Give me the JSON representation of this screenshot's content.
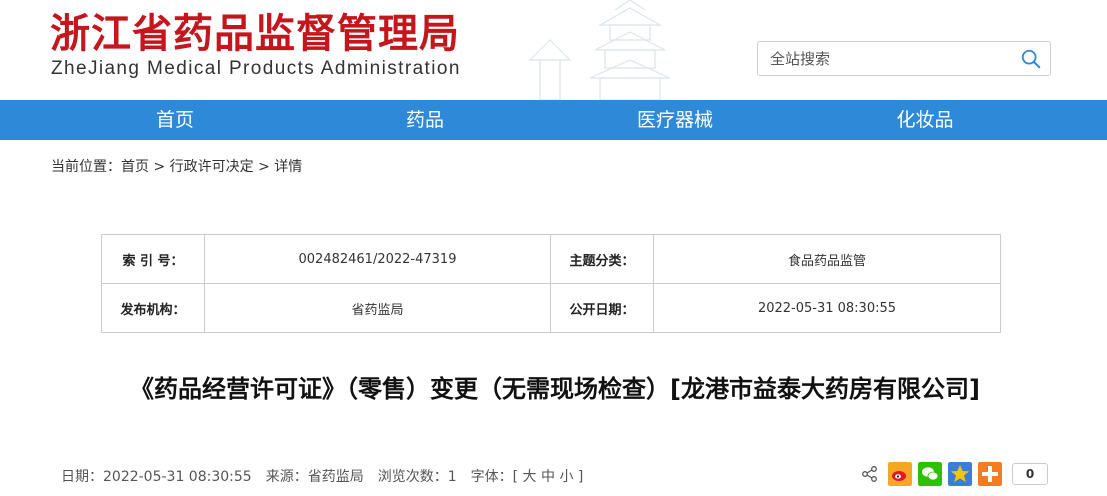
{
  "header": {
    "title_cn": "浙江省药品监督管理局",
    "title_en": "ZheJiang Medical Products Administration",
    "search_placeholder": "全站搜索"
  },
  "nav": {
    "items": [
      "首页",
      "药品",
      "医疗器械",
      "化妆品"
    ]
  },
  "breadcrumb": {
    "prefix": "当前位置：",
    "items": [
      "首页",
      "行政许可决定",
      "详情"
    ],
    "separator": ">"
  },
  "info": {
    "index_label": "索 引 号：",
    "index_value": "002482461/2022-47319",
    "topic_label": "主题分类：",
    "topic_value": "食品药品监管",
    "publisher_label": "发布机构：",
    "publisher_value": "省药监局",
    "date_label": "公开日期：",
    "date_value": "2022-05-31 08:30:55"
  },
  "article": {
    "title": "《药品经营许可证》（零售）变更（无需现场检查）[龙港市益泰大药房有限公司]"
  },
  "meta": {
    "date": "日期：2022-05-31 08:30:55",
    "source": "来源：省药监局",
    "views": "浏览次数：1",
    "font_label": "字体：[",
    "size_large": "大",
    "size_medium": "中",
    "size_small": "小",
    "font_close": "]"
  },
  "share": {
    "count": "0",
    "icons": [
      "share-icon",
      "weibo-icon",
      "wechat-icon",
      "qzone-icon",
      "more-icon"
    ]
  },
  "colors": {
    "brand_red": "#c4161c",
    "nav_blue": "#2e8ad8"
  }
}
